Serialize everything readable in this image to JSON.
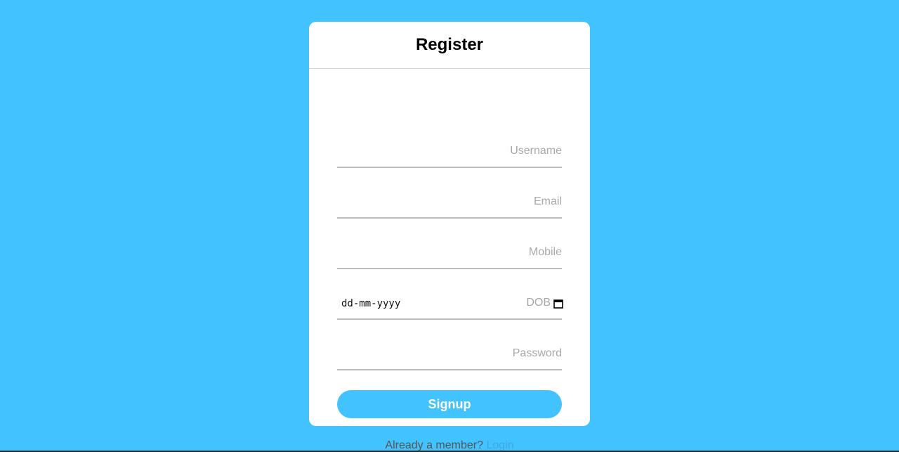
{
  "card": {
    "title": "Register"
  },
  "form": {
    "username_label": "Username",
    "email_label": "Email",
    "mobile_label": "Mobile",
    "dob_label": "DOB",
    "dob_value": "dd-mm-yyyy",
    "password_label": "Password",
    "signup_label": "Signup"
  },
  "footer": {
    "prompt": "Already a member? ",
    "login_label": "Login"
  },
  "colors": {
    "background": "#42c3ff",
    "accent": "#42c3ff",
    "link": "#3aa8e8"
  },
  "icons": {
    "dob": "calendar-icon"
  }
}
